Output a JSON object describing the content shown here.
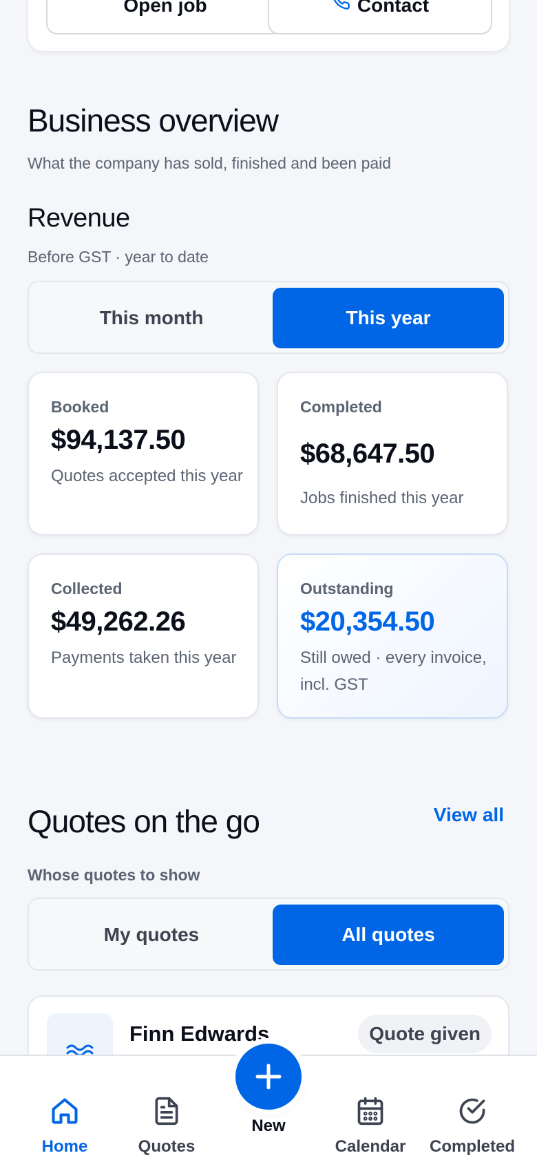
{
  "top_actions": {
    "open_job_label": "Open job",
    "contact_label": "Contact"
  },
  "overview": {
    "title": "Business overview",
    "subtitle": "What the company has sold, finished and been paid"
  },
  "revenue": {
    "title": "Revenue",
    "subtitle": "Before GST · year to date",
    "period_toggle": {
      "options": [
        "This month",
        "This year"
      ],
      "selected": "This year"
    },
    "stats": [
      {
        "label": "Booked",
        "value": "$94,137.50",
        "description": "Quotes accepted this year"
      },
      {
        "label": "Completed",
        "value": "$68,647.50",
        "description": "Jobs finished this year"
      },
      {
        "label": "Collected",
        "value": "$49,262.26",
        "description": "Payments taken this year"
      },
      {
        "label": "Outstanding",
        "value": "$20,354.50",
        "description": "Still owed · every invoice, incl. GST"
      }
    ]
  },
  "quotes": {
    "title": "Quotes on the go",
    "view_all_label": "View all",
    "filter_label": "Whose quotes to show",
    "filter_toggle": {
      "options": [
        "My quotes",
        "All quotes"
      ],
      "selected": "All quotes"
    },
    "items": [
      {
        "name": "Finn Edwards",
        "status": "Quote given",
        "icon": "water-waves-icon"
      }
    ]
  },
  "bottom_nav": {
    "items": [
      {
        "label": "Home",
        "icon": "home-icon",
        "active": true
      },
      {
        "label": "Quotes",
        "icon": "document-icon",
        "active": false
      },
      {
        "label": "New",
        "icon": "plus-icon",
        "active": false
      },
      {
        "label": "Calendar",
        "icon": "calendar-icon",
        "active": false
      },
      {
        "label": "Completed",
        "icon": "check-circle-icon",
        "active": false
      }
    ]
  },
  "colors": {
    "accent": "#0066e6",
    "background": "#f4f6f9",
    "muted_text": "#5b6472"
  }
}
